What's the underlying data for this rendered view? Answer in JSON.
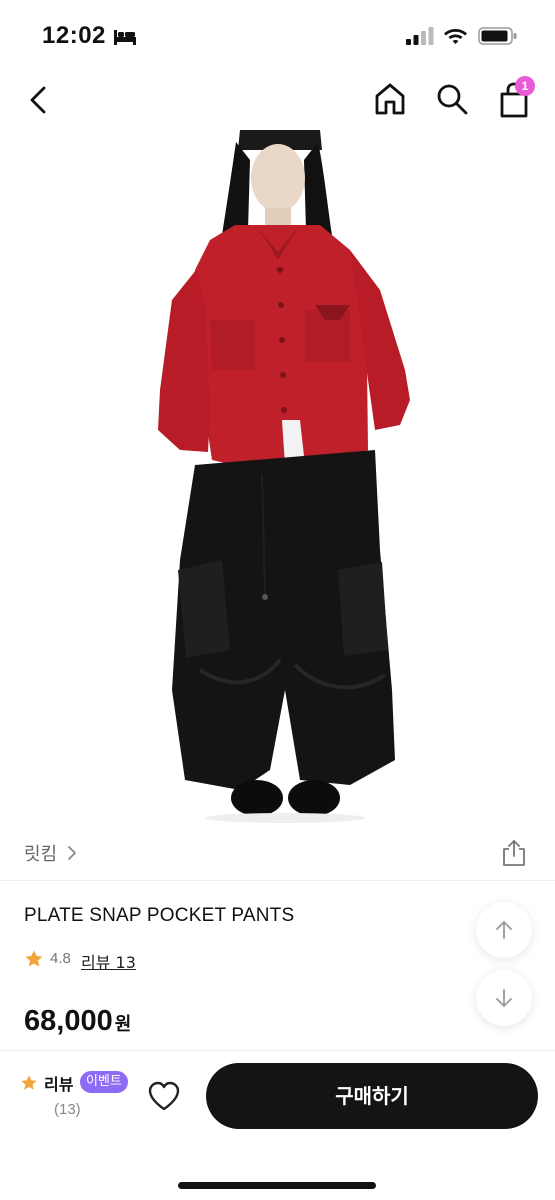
{
  "status_bar": {
    "time": "12:02"
  },
  "nav": {
    "cart_count": "1"
  },
  "product": {
    "brand": "릿킴",
    "title": "PLATE SNAP POCKET PANTS",
    "rating": "4.8",
    "review_link": "리뷰 13",
    "price": "68,000",
    "price_unit": "원"
  },
  "bottom_bar": {
    "review_label": "리뷰",
    "event_badge": "이벤트",
    "review_count": "(13)",
    "buy_label": "구매하기"
  },
  "colors": {
    "accent_badge": "#e85ad6",
    "event_badge": "#8c6cf6",
    "star": "#f4a43a",
    "buy_button": "#141414",
    "shirt": "#c0202a"
  },
  "icons": [
    "bed-icon",
    "signal-icon",
    "wifi-icon",
    "battery-icon",
    "back-arrow-icon",
    "home-icon",
    "search-icon",
    "cart-icon",
    "chevron-right-icon",
    "share-icon",
    "star-icon",
    "arrow-up-icon",
    "arrow-down-icon",
    "heart-icon"
  ]
}
